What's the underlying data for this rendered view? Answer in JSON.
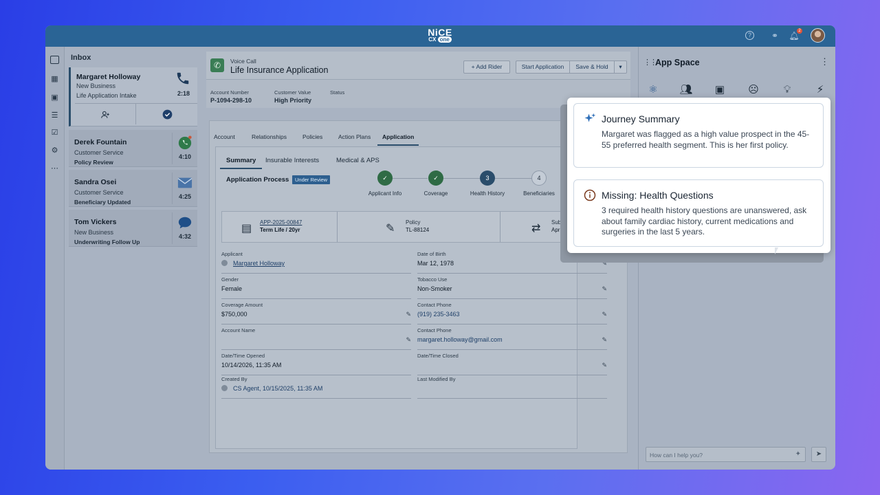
{
  "topbar": {
    "logo_line1": "NiCE",
    "logo_line2": "CX",
    "logo_badge": "one",
    "notification_count": "2"
  },
  "inbox": {
    "title": "Inbox",
    "items": [
      {
        "name": "Margaret Holloway",
        "type": "New Business",
        "status": "Life Application Intake",
        "time": "2:18",
        "channel": "phone-icon"
      },
      {
        "name": "Derek Fountain",
        "type": "Customer Service",
        "status": "Policy Review",
        "time": "4:10",
        "channel": "whatsapp-icon"
      },
      {
        "name": "Sandra Osei",
        "type": "Customer Service",
        "status": "Beneficiary Updated",
        "time": "4:25",
        "channel": "email-icon"
      },
      {
        "name": "Tom Vickers",
        "type": "New Business",
        "status": "Underwriting Follow Up",
        "time": "4:32",
        "channel": "chat-icon"
      }
    ]
  },
  "header": {
    "call_type": "Voice Call",
    "title": "Life Insurance Application",
    "add_rider": "Add Rider",
    "start_application": "Start Application",
    "save_hold": "Save & Hold"
  },
  "meta": {
    "account_number_label": "Account Number",
    "account_number": "P-1094-298-10",
    "customer_value_label": "Customer Value",
    "customer_value": "High Priority",
    "status_label": "Status"
  },
  "tabs": [
    "Account",
    "Relationships",
    "Policies",
    "Action Plans",
    "Application"
  ],
  "subtabs": [
    "Summary",
    "Insurable Interests",
    "Medical & APS"
  ],
  "process": {
    "title": "Application Process",
    "badge": "Under Review",
    "steps": [
      {
        "label": "Applicant Info",
        "num": "",
        "state": "done"
      },
      {
        "label": "Coverage",
        "num": "",
        "state": "done"
      },
      {
        "label": "Health History",
        "num": "3",
        "state": "current"
      },
      {
        "label": "Beneficiaries",
        "num": "4",
        "state": "next"
      }
    ]
  },
  "info_cards": [
    {
      "label": "APP-2025-00847",
      "value": "Term Life / 20yr"
    },
    {
      "label": "Policy",
      "value": "TL-88124"
    },
    {
      "label": "Submit",
      "value": "April 14"
    }
  ],
  "fields": {
    "applicant_label": "Applicant",
    "applicant": "Margaret Holloway",
    "dob_label": "Date of Birth",
    "dob": "Mar 12, 1978",
    "gender_label": "Gender",
    "gender": "Female",
    "tobacco_label": "Tobacco Use",
    "tobacco": "Non-Smoker",
    "coverage_label": "Coverage Amount",
    "coverage": "$750,000",
    "phone_label": "Contact Phone",
    "phone": "(919) 235-3463",
    "account_name_label": "Account Name",
    "account_name": "",
    "email_label": "Contact Phone",
    "email": "margaret.holloway@gmail.com",
    "opened_label": "Date/Time Opened",
    "opened": "10/14/2026, 11:35 AM",
    "closed_label": "Date/Time Closed",
    "closed": "",
    "created_label": "Created By",
    "created": "CS Agent, 10/15/2025, 11:35 AM",
    "modified_label": "Last Modified By",
    "modified": ""
  },
  "app_space": {
    "title": "App Space",
    "chat_placeholder": "How can I help you?"
  },
  "popup": {
    "journey_title": "Journey Summary",
    "journey_body": "Margaret was flagged as a high value prospect in the 45-55 preferred health segment. This is her first policy.",
    "missing_title": "Missing: Health Questions",
    "missing_body": "3 required health history questions are unanswered, ask about family cardiac history, current medications and surgeries in the last 5 years."
  }
}
